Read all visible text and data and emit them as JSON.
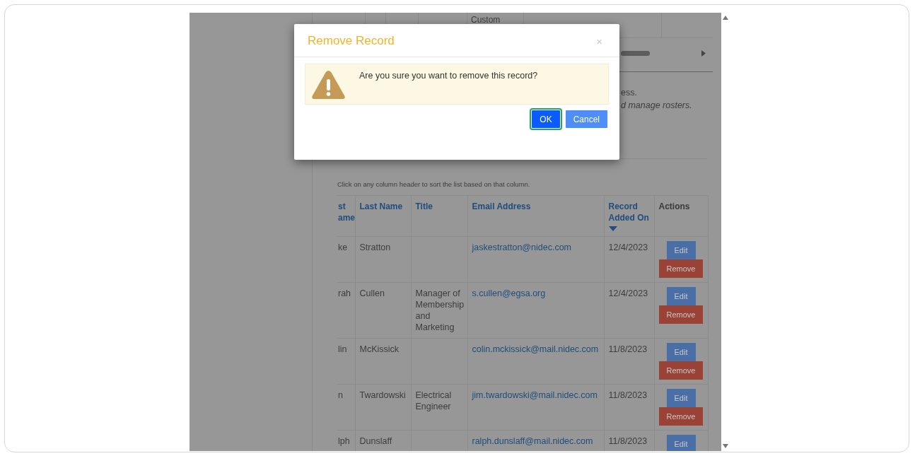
{
  "background_table": {
    "cell_text": "Custom"
  },
  "intro": {
    "line_1": "ess.",
    "line_2": "d manage rosters."
  },
  "hint": "Click on any column header to sort the list based on that column.",
  "table": {
    "columns": [
      {
        "label": "st ame",
        "sortable": true,
        "sorted_descending": false
      },
      {
        "label": "Last Name",
        "sortable": true,
        "sorted_descending": false
      },
      {
        "label": "Title",
        "sortable": true,
        "sorted_descending": false
      },
      {
        "label": "Email Address",
        "sortable": true,
        "sorted_descending": false
      },
      {
        "label": "Record Added On",
        "sortable": true,
        "sorted_descending": true
      },
      {
        "label": "Actions",
        "sortable": false,
        "sorted_descending": false
      }
    ],
    "rows": [
      {
        "first_name": "ke",
        "last_name": "Stratton",
        "title": "",
        "email": "jaskestratton@nidec.com",
        "added_on": "12/4/2023",
        "actions": [
          "Edit",
          "Remove"
        ]
      },
      {
        "first_name": "rah",
        "last_name": "Cullen",
        "title": "Manager of Membership and Marketing",
        "email": "s.cullen@egsa.org",
        "added_on": "12/4/2023",
        "actions": [
          "Edit",
          "Remove"
        ]
      },
      {
        "first_name": "lin",
        "last_name": "McKissick",
        "title": "",
        "email": "colin.mckissick@mail.nidec.com",
        "added_on": "11/8/2023",
        "actions": [
          "Edit",
          "Remove"
        ]
      },
      {
        "first_name": "n",
        "last_name": "Twardowski",
        "title": "Electrical Engineer",
        "email": "jim.twardowski@mail.nidec.com",
        "added_on": "11/8/2023",
        "actions": [
          "Edit",
          "Remove"
        ]
      },
      {
        "first_name": "lph",
        "last_name": "Dunslaff",
        "title": "",
        "email": "ralph.dunslaff@mail.nidec.com",
        "added_on": "11/8/2023",
        "actions": [
          "Edit"
        ]
      }
    ]
  },
  "modal": {
    "title": "Remove Record",
    "close": "×",
    "message": "Are you sure you want to remove this record?",
    "buttons": [
      {
        "label": "OK",
        "kind": "primary",
        "focused": true
      },
      {
        "label": "Cancel",
        "kind": "secondary",
        "focused": false
      }
    ]
  }
}
